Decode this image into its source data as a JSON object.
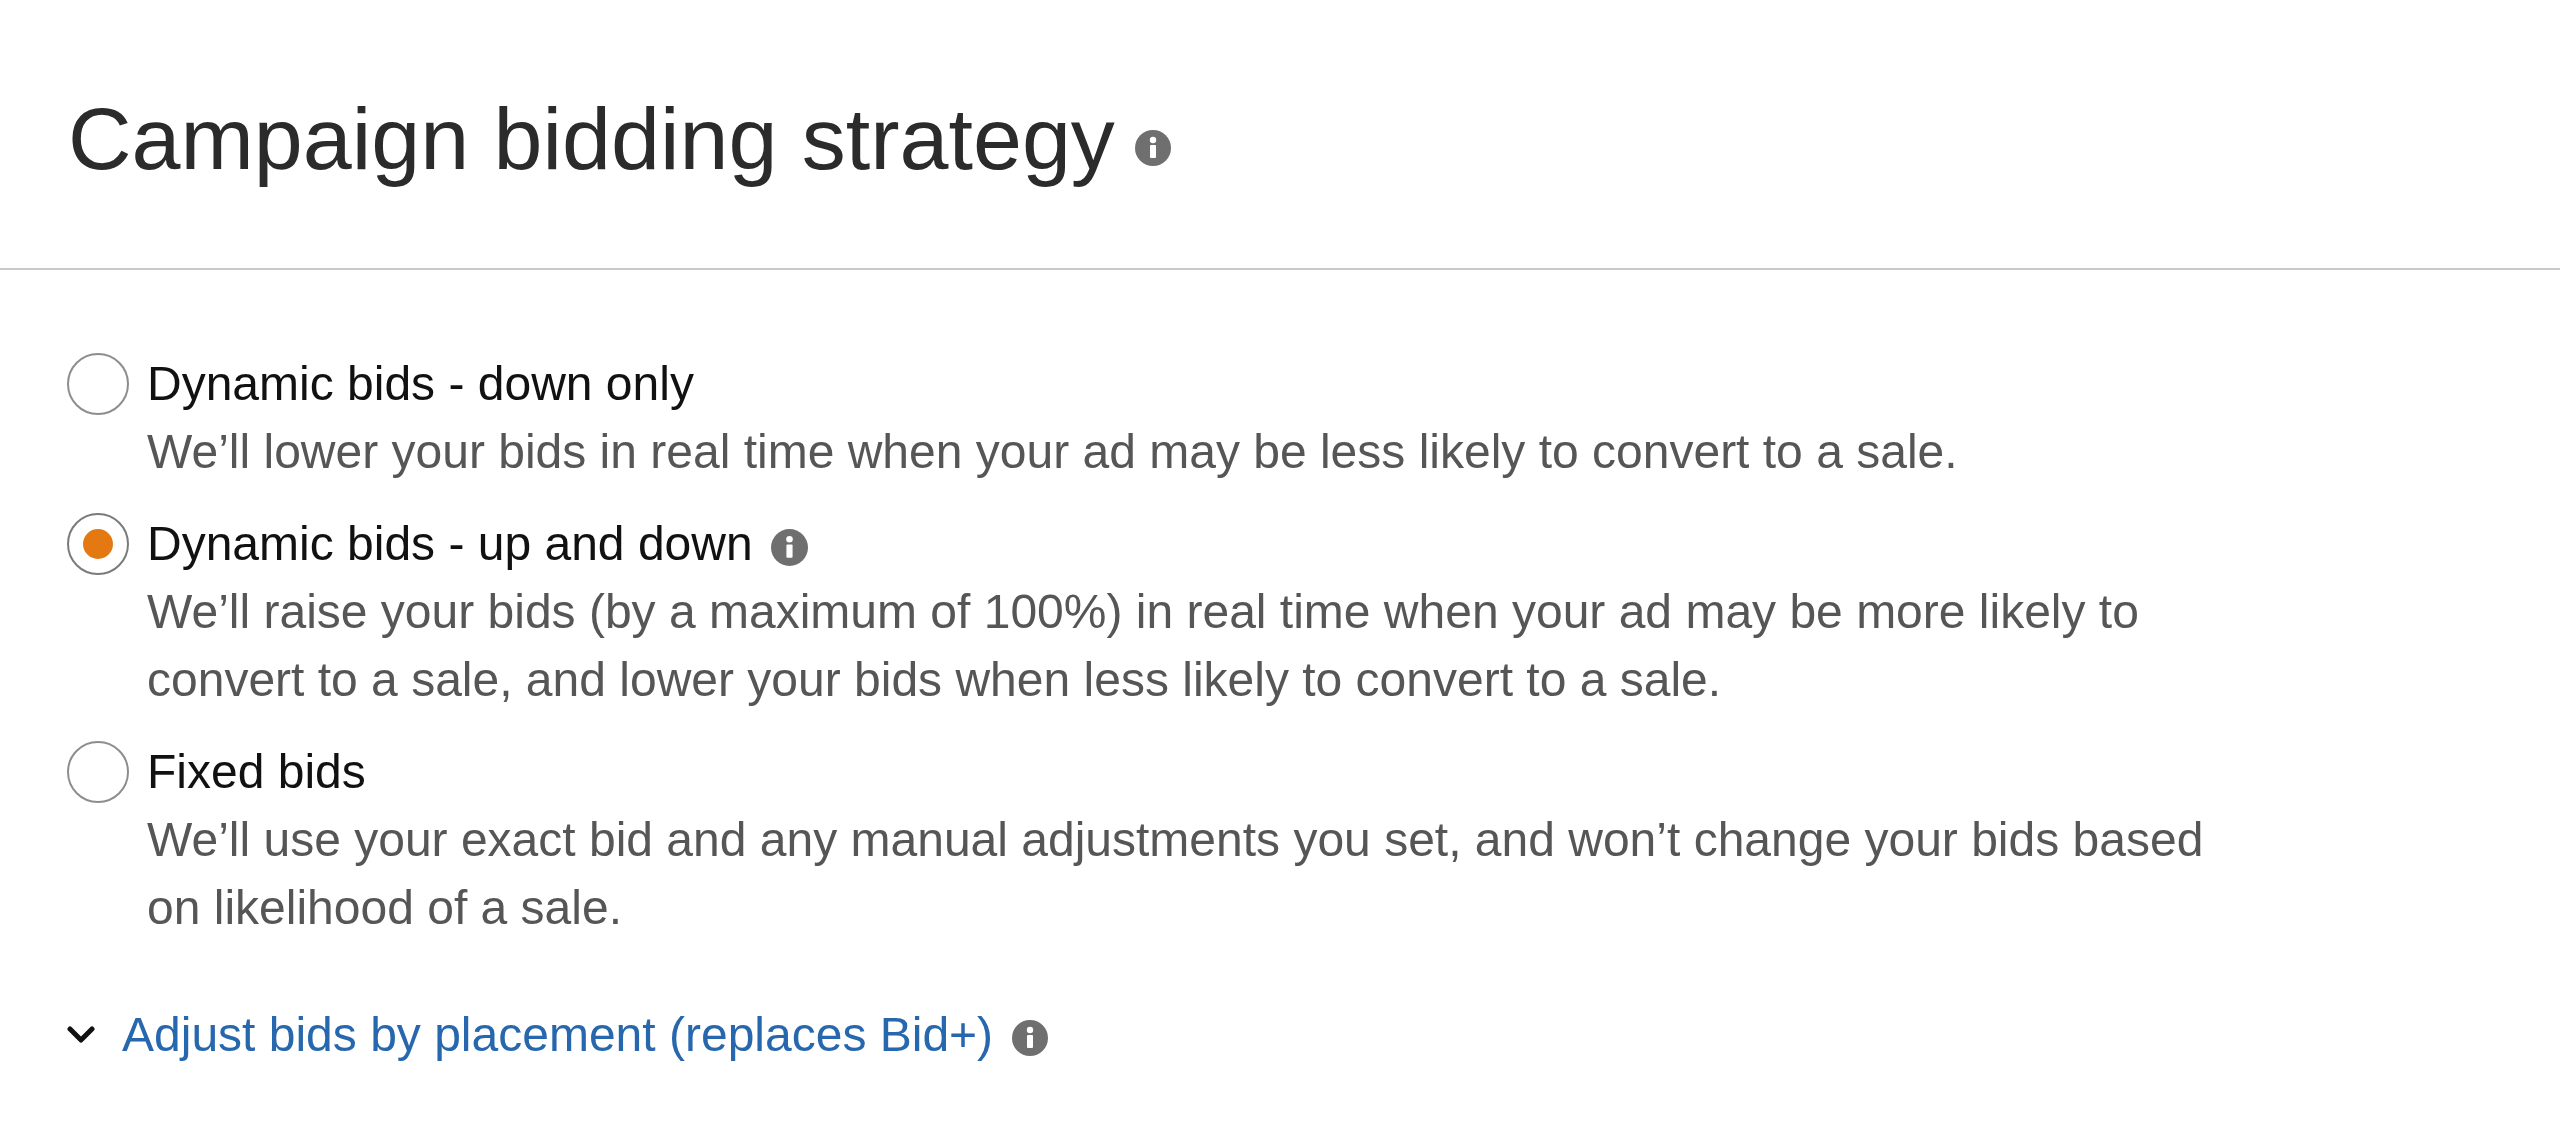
{
  "title": "Campaign bidding strategy",
  "options": [
    {
      "label": "Dynamic bids - down only",
      "description": "We’ll lower your bids in real time when your ad may be less likely to convert to a sale.",
      "selected": false,
      "info": false
    },
    {
      "label": "Dynamic bids - up and down",
      "description": "We’ll raise your bids (by a maximum of 100%) in real time when your ad may be more likely to convert to a sale, and lower your bids when less likely to convert to a sale.",
      "selected": true,
      "info": true
    },
    {
      "label": "Fixed bids",
      "description": "We’ll use your exact bid and any manual adjustments you set, and won’t change your bids based on likelihood of a sale.",
      "selected": false,
      "info": false
    }
  ],
  "placement_link": {
    "label": "Adjust bids by placement (replaces Bid+)"
  }
}
